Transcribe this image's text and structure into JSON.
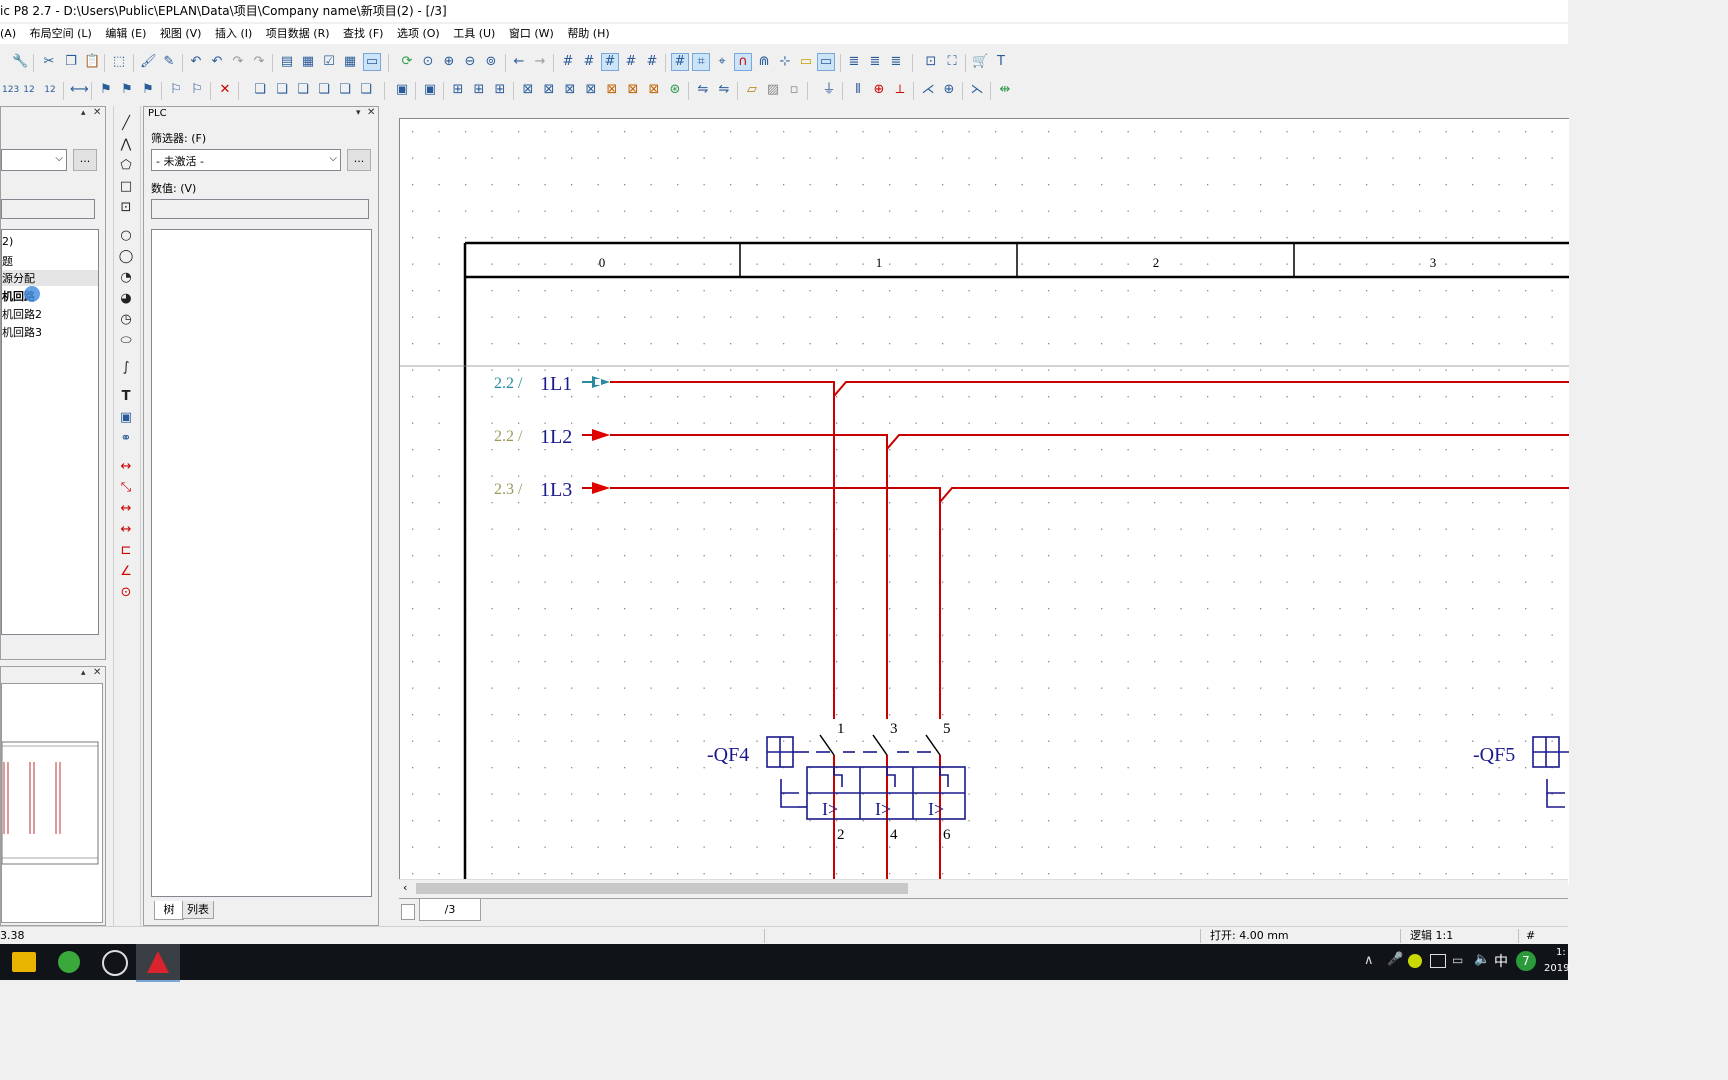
{
  "window": {
    "title": "ic P8 2.7 - D:\\Users\\Public\\EPLAN\\Data\\项目\\Company name\\新项目(2) - [/3]"
  },
  "menu": [
    "(A)",
    "布局空间 (L)",
    "编辑 (E)",
    "视图 (V)",
    "插入 (I)",
    "项目数据 (R)",
    "查找 (F)",
    "选项 (O)",
    "工具 (U)",
    "窗口 (W)",
    "帮助 (H)"
  ],
  "left_panel": {
    "tree_items": [
      "2)",
      "题",
      "源分配",
      "机回路",
      "机回路2",
      "机回路3"
    ],
    "selected_index": 2,
    "bold_index": 3,
    "browse_label": "..."
  },
  "plc_panel": {
    "title": "PLC",
    "filter_label": "筛选器: (F)",
    "filter_value": "- 未激活 -",
    "browse_label": "...",
    "value_label": "数值: (V)",
    "value_input": "",
    "tabs": [
      "树",
      "列表"
    ]
  },
  "drawing": {
    "columns": [
      "0",
      "1",
      "2",
      "3"
    ],
    "potentials": [
      {
        "ref": "2.2 /",
        "name": "1L1",
        "style": "start"
      },
      {
        "ref": "2.2 /",
        "name": "1L2",
        "style": "arrow"
      },
      {
        "ref": "2.3 /",
        "name": "1L3",
        "style": "arrow"
      }
    ],
    "device1": {
      "name": "-QF4",
      "top_terminals": [
        "1",
        "3",
        "5"
      ],
      "bottom_terminals": [
        "2",
        "4",
        "6"
      ],
      "trip_label": "I>"
    },
    "device2": {
      "name": "-QF5"
    },
    "colors": {
      "wire": "#c80000",
      "symbol": "#1a1a8c",
      "ref_text": "#9a9a55",
      "start_marker": "#2a8aa0"
    }
  },
  "page_tab": "/3",
  "status": {
    "left": "3.38",
    "open": "打开: 4.00 mm",
    "logic": "逻辑 1:1",
    "hash": "#"
  },
  "taskbar": {
    "ime": "中",
    "badge": "7",
    "clock_year": "2019",
    "clock_time": "1:"
  }
}
